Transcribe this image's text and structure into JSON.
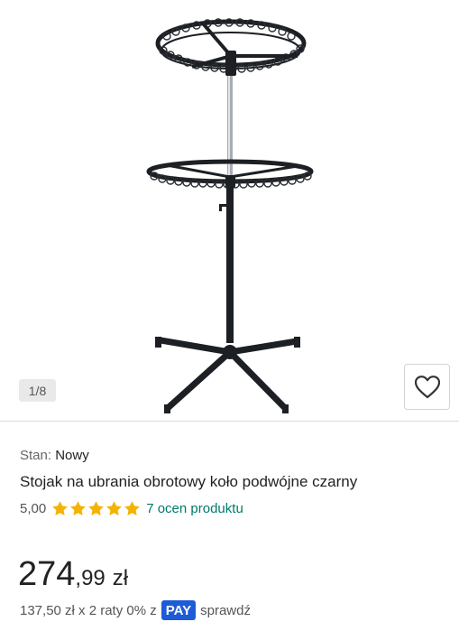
{
  "gallery": {
    "image_alt": "Stojak na ubrania obrotowy koło podwójne czarny",
    "counter": "1/8",
    "favorite_icon": "heart-icon"
  },
  "product": {
    "condition_label": "Stan:",
    "condition_value": "Nowy",
    "title": "Stojak na ubrania obrotowy koło podwójne czarny",
    "rating_value": "5,00",
    "stars": 5,
    "star_color": "#f5b301",
    "reviews_link": "7 ocen produktu",
    "reviews_link_color": "#00796b",
    "price_integer": "274",
    "price_decimal": ",99",
    "price_currency": "zł",
    "installments_text": "137,50 zł x 2 raty 0% z",
    "pay_badge": "PAY",
    "pay_badge_color": "#1e5bd6",
    "check_link": "sprawdź"
  }
}
